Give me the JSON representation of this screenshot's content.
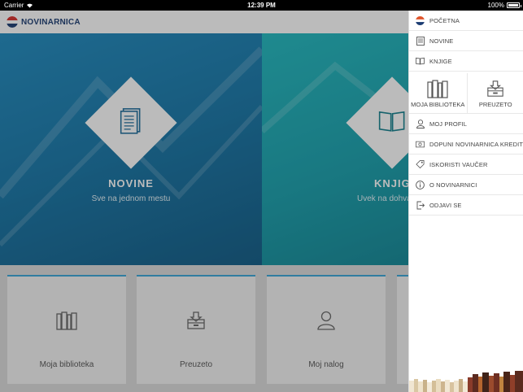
{
  "status": {
    "carrier": "Carrier",
    "time": "12:39 PM",
    "battery": "100%"
  },
  "app": {
    "logo_text": "NOVINARNICA"
  },
  "hero": {
    "left": {
      "title": "NOVINE",
      "subtitle": "Sve na jednom mestu"
    },
    "right": {
      "title": "KNJIGE",
      "subtitle": "Uvek na dohva"
    }
  },
  "cards": [
    {
      "label": "Moja biblioteka",
      "icon": "library-icon"
    },
    {
      "label": "Preuzeto",
      "icon": "download-tray-icon"
    },
    {
      "label": "Moj nalog",
      "icon": "user-icon"
    }
  ],
  "menu": {
    "items": [
      {
        "label": "POČETNA",
        "icon": "home-logo-icon"
      },
      {
        "label": "NOVINE",
        "icon": "newspaper-icon"
      },
      {
        "label": "KNJIGE",
        "icon": "book-icon"
      },
      {
        "label": "MOJ PROFIL",
        "icon": "user-icon"
      },
      {
        "label": "DOPUNI NOVINARNICA KREDIT",
        "icon": "cash-icon"
      },
      {
        "label": "ISKORISTI VAUČER",
        "icon": "tag-icon"
      },
      {
        "label": "O NOVINARNICI",
        "icon": "info-icon"
      },
      {
        "label": "ODJAVI SE",
        "icon": "logout-icon"
      }
    ],
    "tiles": [
      {
        "label": "MOJA BIBLIOTEKA",
        "icon": "library-icon"
      },
      {
        "label": "PREUZETO",
        "icon": "download-tray-icon"
      }
    ]
  },
  "colors": {
    "accent": "#39a7d8",
    "brand": "#1c3d73",
    "hero_left": "#1677a9",
    "hero_right": "#17a0ad"
  }
}
